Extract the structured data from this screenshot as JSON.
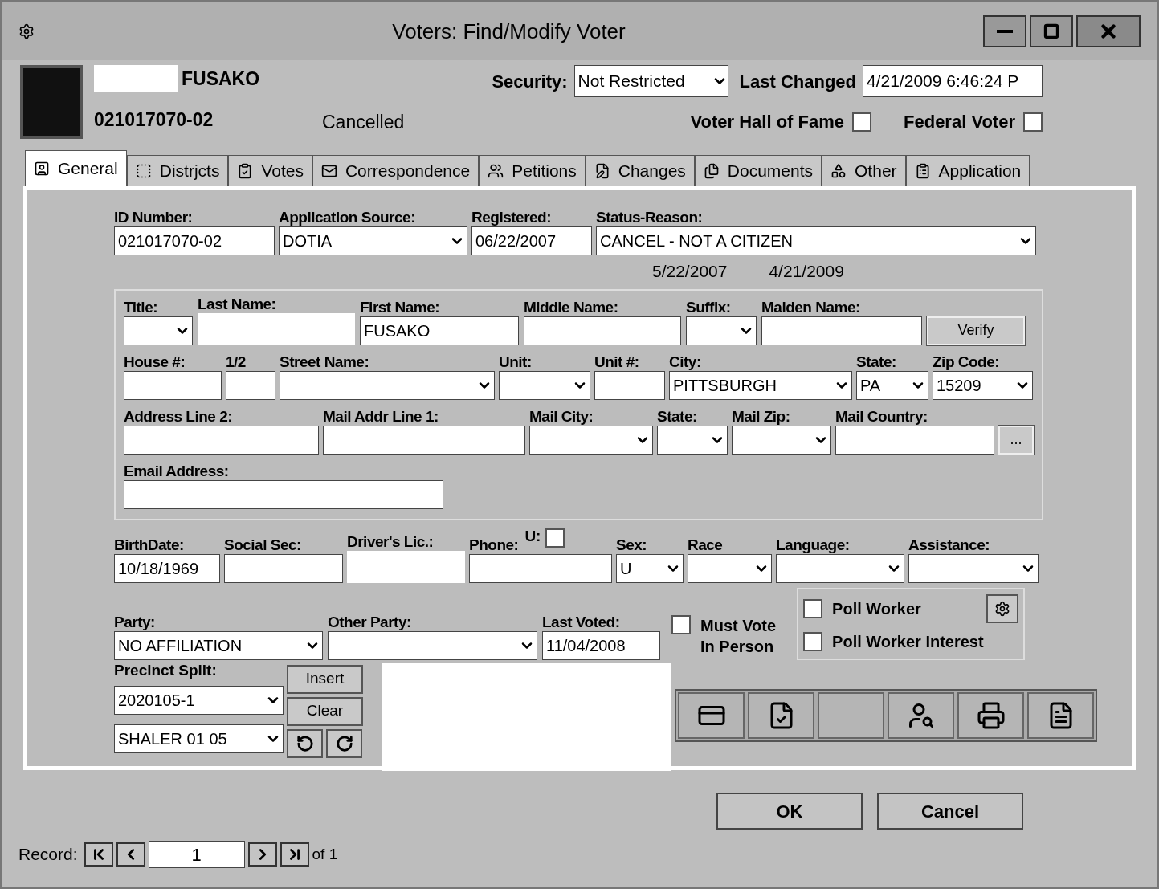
{
  "window": {
    "title": "Voters: Find/Modify Voter"
  },
  "header": {
    "name": "FUSAKO",
    "voter_id": "021017070-02",
    "status": "Cancelled",
    "security_label": "Security:",
    "security": "Not Restricted",
    "last_changed_label": "Last Changed",
    "last_changed": "4/21/2009 6:46:24 P",
    "checks": [
      {
        "label": "Voter Hall of Fame",
        "checked": false
      },
      {
        "label": "Federal Voter",
        "checked": false
      }
    ]
  },
  "tabs": [
    {
      "label": "General",
      "selected": true
    },
    {
      "label": "Distrjcts",
      "selected": false
    },
    {
      "label": "Votes",
      "selected": false
    },
    {
      "label": "Correspondence",
      "selected": false
    },
    {
      "label": "Petitions",
      "selected": false
    },
    {
      "label": "Changes",
      "selected": false
    },
    {
      "label": "Documents",
      "selected": false
    },
    {
      "label": "Other",
      "selected": false
    },
    {
      "label": "Application",
      "selected": false
    }
  ],
  "registration": [
    {
      "label": "ID Number:",
      "kind": "text",
      "value": "021017070-02"
    },
    {
      "label": "Application Source:",
      "kind": "select",
      "value": "DOTIA"
    },
    {
      "label": "Registered:",
      "kind": "text",
      "value": "06/22/2007"
    },
    {
      "label": "Status-Reason:",
      "kind": "select",
      "value": "CANCEL - NOT A CITIZEN"
    }
  ],
  "status_dates": [
    "5/22/2007",
    "4/21/2009"
  ],
  "name_rows": [
    [
      {
        "label": "Title:",
        "kind": "select"
      },
      {
        "label": "Last Name:",
        "kind": "redacted"
      },
      {
        "label": "First Name:",
        "kind": "text",
        "value": "FUSAKO"
      },
      {
        "label": "Middle Name:",
        "kind": "text"
      },
      {
        "label": "Suffix:",
        "kind": "select"
      },
      {
        "label": "Maiden Name:",
        "kind": "text"
      },
      {
        "kind": "button",
        "value": "Verify"
      }
    ],
    [
      {
        "label": "House #:",
        "kind": "text"
      },
      {
        "label": "1/2",
        "kind": "text"
      },
      {
        "label": "Street Name:",
        "kind": "select"
      },
      {
        "label": "Unit:",
        "kind": "select"
      },
      {
        "label": "Unit #:",
        "kind": "text"
      },
      {
        "label": "City:",
        "kind": "select",
        "value": "PITTSBURGH"
      },
      {
        "label": "State:",
        "kind": "select",
        "value": "PA"
      },
      {
        "label": "Zip Code:",
        "kind": "select",
        "value": "15209"
      }
    ],
    [
      {
        "label": "Address Line 2:",
        "kind": "text"
      },
      {
        "label": "Mail Addr Line 1:",
        "kind": "text"
      },
      {
        "label": "Mail City:",
        "kind": "select"
      },
      {
        "label": "State:",
        "kind": "select"
      },
      {
        "label": "Mail Zip:",
        "kind": "select"
      },
      {
        "label": "Mail Country:",
        "kind": "text"
      },
      {
        "kind": "button",
        "value": "..."
      }
    ],
    [
      {
        "label": "Email Address:",
        "kind": "text"
      }
    ]
  ],
  "personal": [
    {
      "label": "BirthDate:",
      "kind": "text",
      "value": "10/18/1969"
    },
    {
      "label": "Social Sec:",
      "kind": "text"
    },
    {
      "label": "Driver's Lic.:",
      "kind": "redacted"
    },
    {
      "label": "Phone:",
      "kind": "text"
    },
    {
      "label": "Sex:",
      "kind": "select",
      "value": "U"
    },
    {
      "label": "Race",
      "kind": "select"
    },
    {
      "label": "Language:",
      "kind": "select"
    },
    {
      "label": "Assistance:",
      "kind": "select"
    }
  ],
  "phone_flag": {
    "label": "U:",
    "checked": false
  },
  "party": [
    {
      "label": "Party:",
      "kind": "select",
      "value": "NO AFFILIATION"
    },
    {
      "label": "Other Party:",
      "kind": "select"
    },
    {
      "label": "Last Voted:",
      "kind": "text",
      "value": "11/04/2008"
    }
  ],
  "must_vote": {
    "label_lines": [
      "Must Vote",
      "In Person"
    ],
    "checked": false
  },
  "poll": [
    {
      "label": "Poll Worker",
      "checked": false
    },
    {
      "label": "Poll Worker Interest",
      "checked": false
    }
  ],
  "precinct": {
    "label": "Precinct Split:",
    "splits": [
      "2020105-1",
      "SHALER 01 05"
    ],
    "buttons": [
      "Insert",
      "Clear"
    ]
  },
  "dialog_buttons": [
    "OK",
    "Cancel"
  ],
  "record": {
    "label": "Record:",
    "value": "1",
    "total": "of 1"
  }
}
